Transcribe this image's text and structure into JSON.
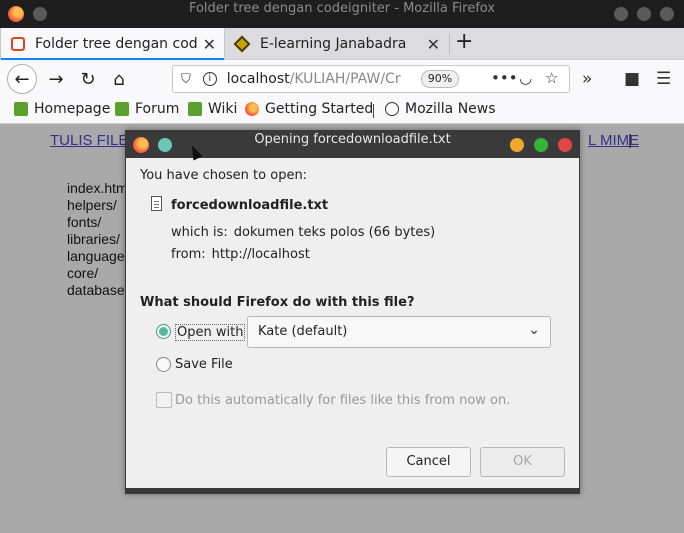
{
  "window": {
    "title": "Folder tree dengan codeigniter - Mozilla Firefox"
  },
  "tabs": [
    {
      "label": "Folder tree dengan codeigniter",
      "active": true
    },
    {
      "label": "E-learning Janabadra",
      "active": false
    }
  ],
  "navbar": {
    "url_host": "localhost",
    "url_path": "/KULIAH/PAW/Cr",
    "zoom": "90%"
  },
  "bookmarks": [
    {
      "label": "Homepage"
    },
    {
      "label": "Forum"
    },
    {
      "label": "Wiki"
    },
    {
      "label": "Getting Started"
    },
    {
      "label": "Mozilla News"
    }
  ],
  "page": {
    "link_left": "TULIS FILE",
    "link_right": "L MIME",
    "pipe": "|",
    "folders": [
      "index.htm",
      "helpers/",
      "fonts/",
      "libraries/",
      "language",
      "core/",
      "database"
    ]
  },
  "dialog": {
    "title": "Opening forcedownloadfile.txt",
    "chosen_text": "You have chosen to open:",
    "filename": "forcedownloadfile.txt",
    "which_is_label": "which is:",
    "which_is_value": "dokumen teks polos (66 bytes)",
    "from_label": "from:",
    "from_value": "http://localhost",
    "question": "What should Firefox do with this file?",
    "open_with_label": "Open with",
    "open_with_app": "Kate (default)",
    "save_file_label": "Save File",
    "auto_label": "Do this automatically for files like this from now on.",
    "cancel_label": "Cancel",
    "ok_label": "OK"
  },
  "colors": {
    "titlebar": "#1e1e1e",
    "dialog_title": "#3a3a3a",
    "accent": "#0a84ff",
    "link": "#3a2e8a",
    "dot_yellow": "#f0a92b",
    "dot_green": "#35b535",
    "dot_red": "#e04848",
    "dot_teal": "#6cc6b8"
  }
}
